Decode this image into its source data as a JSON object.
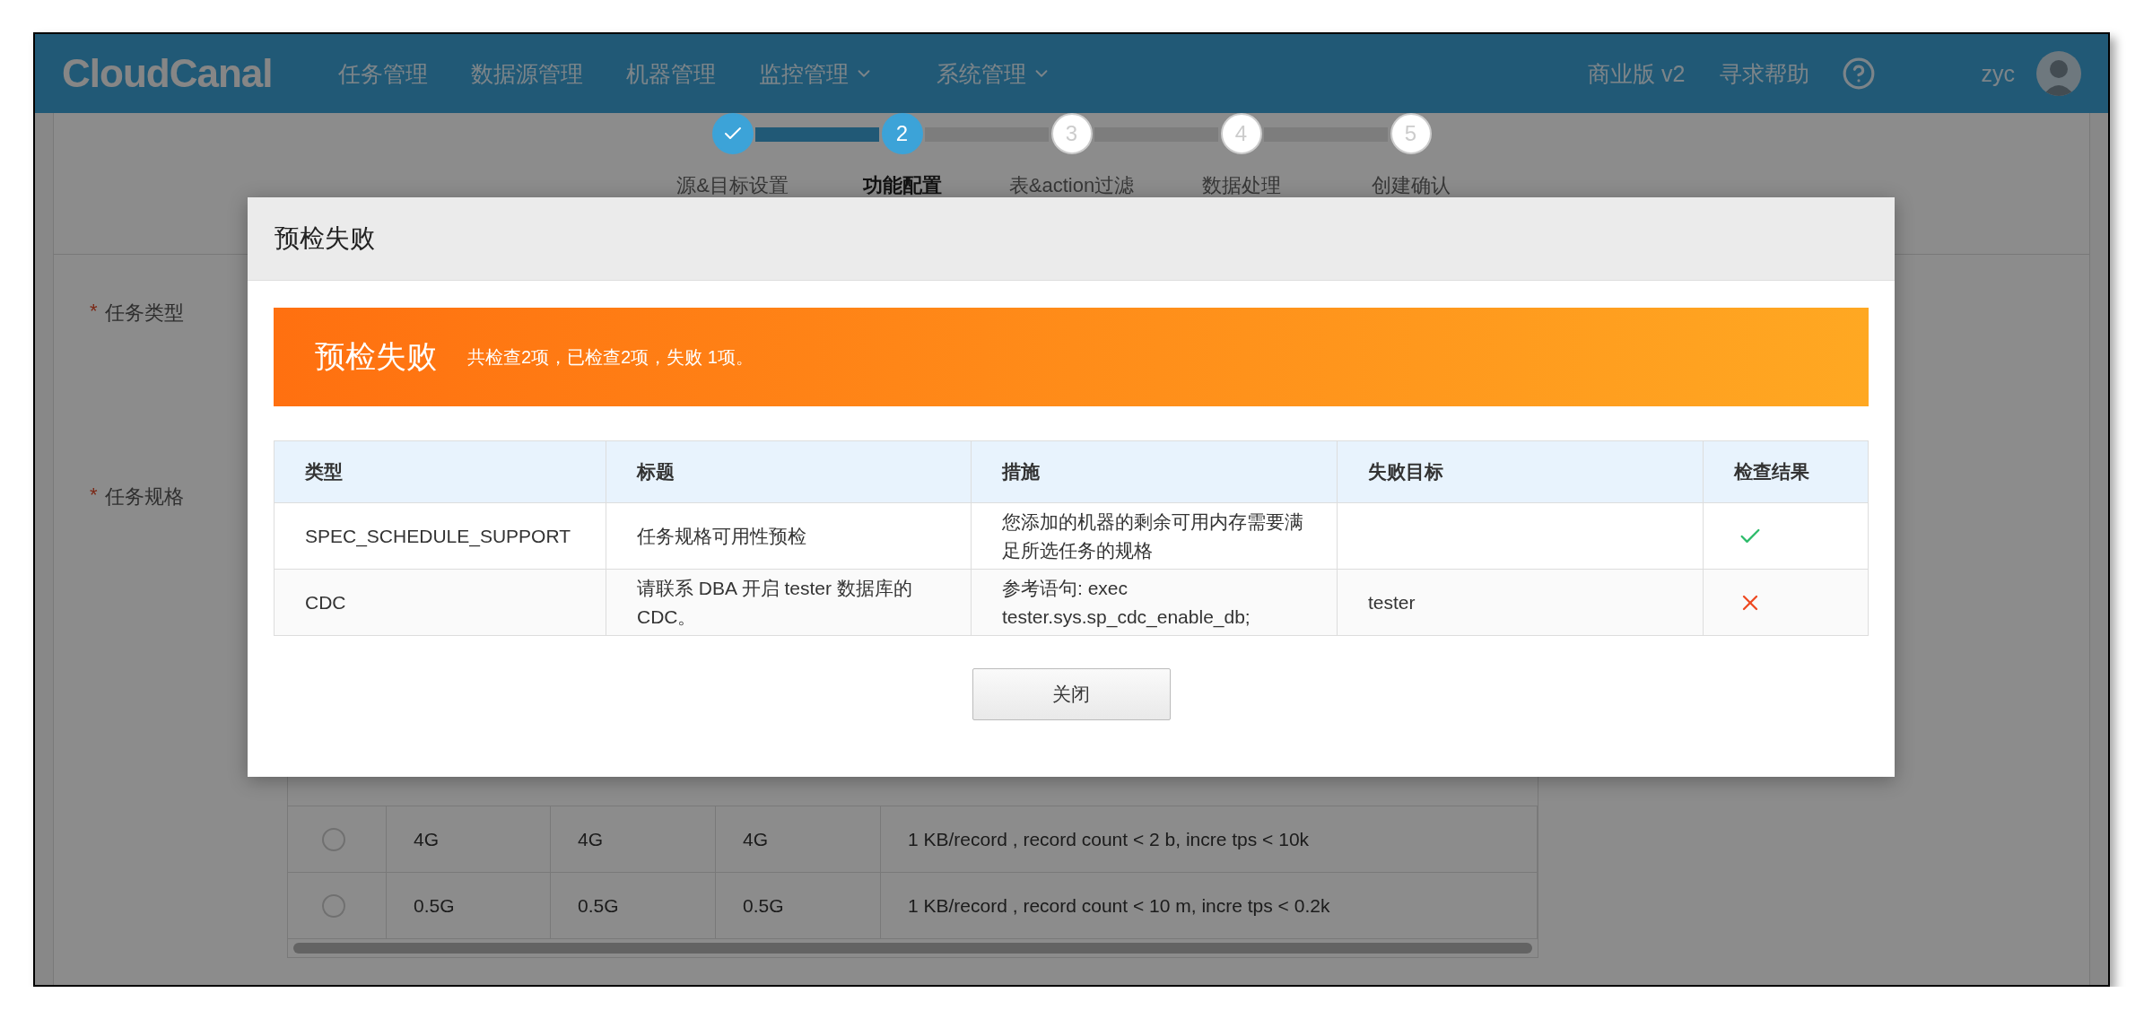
{
  "header": {
    "logo": "CloudCanal",
    "nav": [
      {
        "label": "任务管理",
        "dropdown": false
      },
      {
        "label": "数据源管理",
        "dropdown": false
      },
      {
        "label": "机器管理",
        "dropdown": false
      },
      {
        "label": "监控管理",
        "dropdown": true
      },
      {
        "label": "系统管理",
        "dropdown": true
      }
    ],
    "edition": "商业版 v2",
    "help": "寻求帮助",
    "user": "zyc"
  },
  "steps": [
    {
      "label": "源&目标设置",
      "completed": true,
      "selected": false
    },
    {
      "label": "功能配置",
      "number": "2",
      "completed": false,
      "selected": true
    },
    {
      "label": "表&action过滤",
      "number": "3",
      "completed": false,
      "selected": false
    },
    {
      "label": "数据处理",
      "number": "4",
      "completed": false,
      "selected": false
    },
    {
      "label": "创建确认",
      "number": "5",
      "completed": false,
      "selected": false
    }
  ],
  "form": {
    "fields": [
      {
        "label": "任务类型",
        "required_mark": "*"
      },
      {
        "label": "任务规格",
        "required_mark": "*"
      }
    ],
    "spec_rows": [
      {
        "selected": false,
        "column_2": "4G",
        "column_3": "4G",
        "column_4": "4G",
        "column_5": "1 KB/record , record count < 2 b, incre tps < 10k"
      },
      {
        "selected": false,
        "column_2": "0.5G",
        "column_3": "0.5G",
        "column_4": "0.5G",
        "column_5": "1 KB/record , record count < 10 m, incre tps < 0.2k"
      }
    ]
  },
  "dialog": {
    "title": "预检失败",
    "banner": {
      "title": "预检失败",
      "summary": "共检查2项，已检查2项，失败 1项。"
    },
    "columns": [
      "类型",
      "标题",
      "措施",
      "失败目标",
      "检查结果"
    ],
    "rows": [
      {
        "type": "SPEC_SCHEDULE_SUPPORT",
        "title": "任务规格可用性预检",
        "measure": "您添加的机器的剩余可用内存需要满足所选任务的规格",
        "passed": true
      },
      {
        "type": "CDC",
        "title": "请联系 DBA 开启 tester 数据库的CDC。",
        "measure": "参考语句: exec tester.sys.sp_cdc_enable_db;",
        "target": "tester",
        "passed": false
      }
    ],
    "close_button": "关闭"
  }
}
